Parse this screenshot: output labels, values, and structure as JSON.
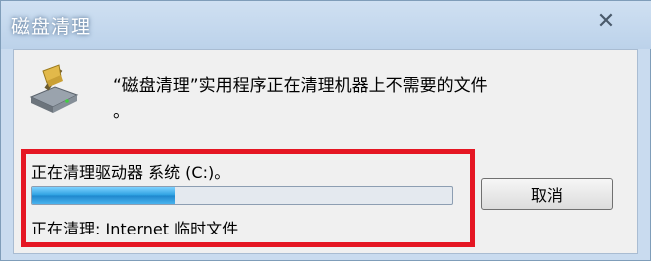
{
  "window": {
    "title": "磁盘清理",
    "close_glyph": "✕"
  },
  "dialog": {
    "message_line1": "“磁盘清理”实用程序正在清理机器上不需要的文件",
    "message_line2": "。",
    "status": "正在清理驱动器 系统 (C:)。",
    "progress_fraction": 0.34,
    "current_item": "正在清理: Internet 临时文件",
    "cancel_label": "取消"
  },
  "colors": {
    "highlight_border": "#e51623",
    "progress_fill": "#2a9fe0"
  },
  "icons": [
    "disk-cleanup-icon",
    "close-icon"
  ]
}
